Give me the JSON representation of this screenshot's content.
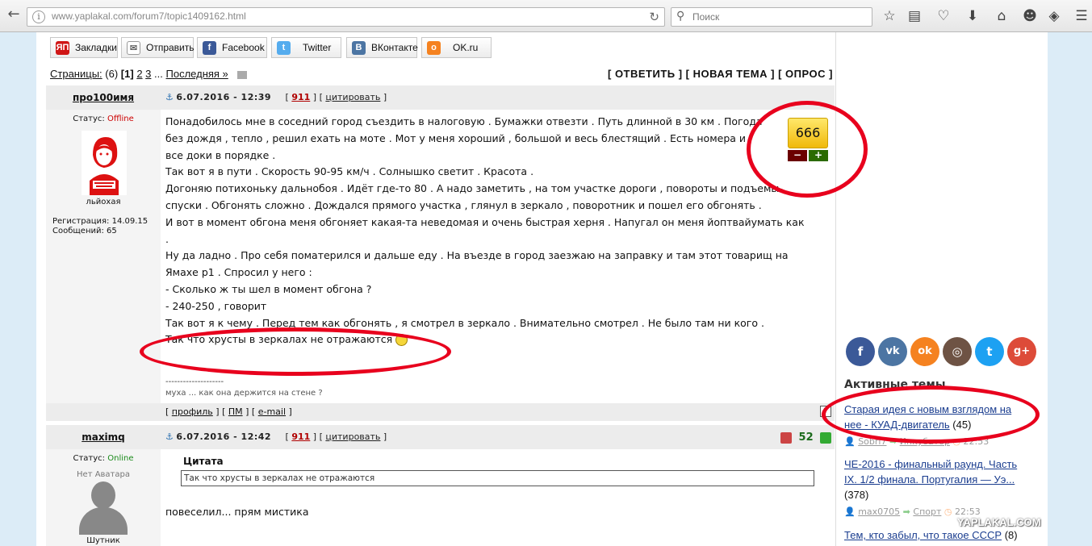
{
  "browser": {
    "url_domain": "www.yaplakal.com",
    "url_path": "/forum7/topic1409162.html",
    "search_placeholder": "Поиск"
  },
  "share": [
    {
      "label": "Закладки",
      "icon": "yap-icon",
      "color": "#d01616"
    },
    {
      "label": "Отправить",
      "icon": "mail-icon",
      "color": "#888888"
    },
    {
      "label": "Facebook",
      "icon": "facebook-icon",
      "color": "#3b5998"
    },
    {
      "label": "Twitter",
      "icon": "twitter-icon",
      "color": "#55acee"
    },
    {
      "label": "ВКонтакте",
      "icon": "vk-icon",
      "color": "#4c75a3"
    },
    {
      "label": "OK.ru",
      "icon": "ok-icon",
      "color": "#f58220"
    }
  ],
  "pager": {
    "label": "Страницы:",
    "count": "(6)",
    "current": "[1]",
    "p2": "2",
    "p3": "3",
    "dots": "...",
    "last": "Последняя »"
  },
  "actions": "[ ОТВЕТИТЬ ] [ НОВАЯ ТЕМА ] [ ОПРОС ]",
  "post1": {
    "author": "про100имя",
    "date": "6.07.2016 - 12:39",
    "number": "911",
    "quote_link": "цитировать",
    "status_label": "Статус:",
    "status": "Offline",
    "nick": "льйохая",
    "reg": "Регистрация: 14.09.15",
    "msgs": "Сообщений: 65",
    "rating": "666",
    "lines": [
      "Понадобилось мне в соседний город съездить в налоговую . Бумажки отвезти . Путь длинной в 30 км . Погода",
      "без дождя , тепло , решил ехать на моте . Мот у меня хороший , большой и весь блестящий . Есть номера и",
      "все доки в порядке .",
      "Так вот я в пути . Скорость 90-95 км/ч . Солнышко светит . Красота .",
      "Догоняю потихоньку дальнобоя . Идёт где-то 80 . А надо заметить , на том участке дороги , повороты и подъемы-",
      "спуски . Обгонять сложно . Дождался прямого участка , глянул в зеркало , поворотник и пошел его обгонять .",
      "И вот в момент обгона меня обгоняет какая-та неведомая и очень быстрая херня . Напугал он меня йоптвайумать как",
      ".",
      "Ну да ладно . Про себя поматерился и дальше еду . На въезде в город заезжаю на заправку и там этот товарищ на",
      "Ямахе р1 . Спросил у него :",
      "- Сколько ж ты шел в момент обгона ?",
      "- 240-250 , говорит",
      "Так вот я к чему . Перед тем как обгонять , я смотрел в зеркало . Внимательно смотрел . Не было там ни кого .",
      "Так что хрусты в зеркалах не отражаются"
    ],
    "sig_line": "--------------------",
    "sig": "муха ... как она держится на стене ?",
    "foot": {
      "profile": "профиль",
      "pm": "ПМ",
      "email": "e-mail"
    }
  },
  "post2": {
    "author": "maximq",
    "date": "6.07.2016 - 12:42",
    "number": "911",
    "quote_link": "цитировать",
    "status_label": "Статус:",
    "status": "Online",
    "no_avatar": "Нет Аватара",
    "nick": "Шутник",
    "votes": "52",
    "quote_title": "Цитата",
    "quote_text": "Так что хрусты в зеркалах не отражаются",
    "text": "повеселил... прям мистика"
  },
  "sidebar": {
    "social": [
      {
        "icon": "facebook-icon",
        "glyph": "f",
        "color": "#3b5998"
      },
      {
        "icon": "vk-icon",
        "glyph": "vk",
        "color": "#4c75a3"
      },
      {
        "icon": "ok-icon",
        "glyph": "ok",
        "color": "#f58220"
      },
      {
        "icon": "instagram-icon",
        "glyph": "◎",
        "color": "#6e5344"
      },
      {
        "icon": "twitter-icon",
        "glyph": "t",
        "color": "#1da1f2"
      },
      {
        "icon": "google-plus-icon",
        "glyph": "g+",
        "color": "#dd4b39"
      }
    ],
    "title": "Активные темы",
    "topics": [
      {
        "line1": "Старая идея с новым взглядом на",
        "line2": "нее - КУАД-двигатель",
        "count": "(45)",
        "user": "Sobri7",
        "forum": "Инкубатор",
        "time": "22:53"
      },
      {
        "line1": "ЧЕ-2016 - финальный раунд. Часть",
        "line2": "IX. 1/2 финала. Португалия — Уэ...",
        "count": "(378)",
        "user": "max0705",
        "forum": "Спорт",
        "time": "22:53"
      },
      {
        "line1": "Тем, кто забыл, что такое СССР",
        "count": "(8)"
      }
    ]
  },
  "watermark": "YAPLAKAL.COM"
}
